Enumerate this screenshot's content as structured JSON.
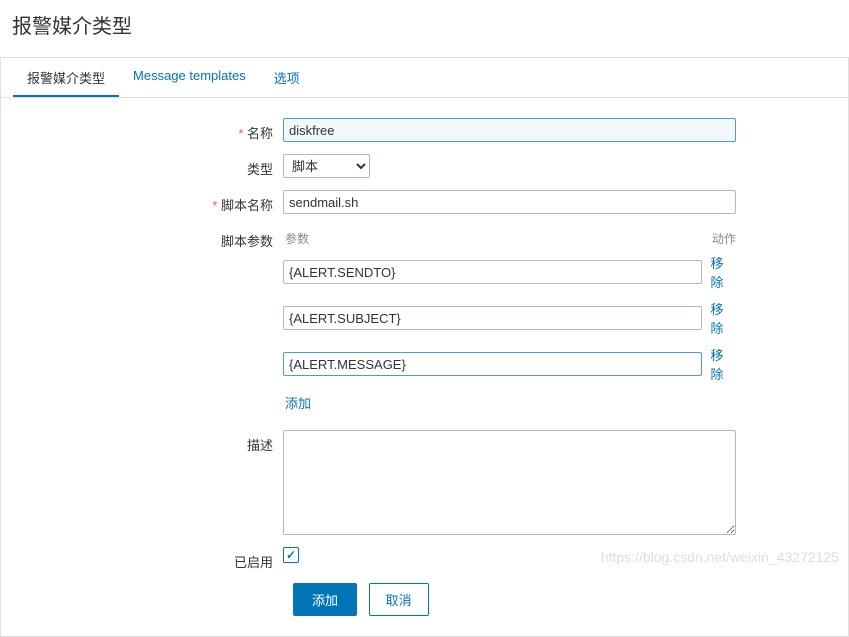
{
  "page_title": "报警媒介类型",
  "tabs": [
    {
      "label": "报警媒介类型",
      "active": true
    },
    {
      "label": "Message templates",
      "active": false
    },
    {
      "label": "选项",
      "active": false
    }
  ],
  "labels": {
    "name": "名称",
    "type": "类型",
    "script_name": "脚本名称",
    "script_params": "脚本参数",
    "description": "描述",
    "enabled": "已启用"
  },
  "fields": {
    "name_value": "diskfree",
    "type_value": "脚本",
    "script_name_value": "sendmail.sh",
    "description_value": "",
    "enabled_checked": true
  },
  "params": {
    "header_param": "参数",
    "header_action": "动作",
    "rows": [
      {
        "value": "{ALERT.SENDTO}",
        "focused": false
      },
      {
        "value": "{ALERT.SUBJECT}",
        "focused": false
      },
      {
        "value": "{ALERT.MESSAGE}",
        "focused": true
      }
    ],
    "remove_label": "移除",
    "add_label": "添加"
  },
  "buttons": {
    "submit": "添加",
    "cancel": "取消"
  },
  "watermark": "https://blog.csdn.net/weixin_43272125"
}
